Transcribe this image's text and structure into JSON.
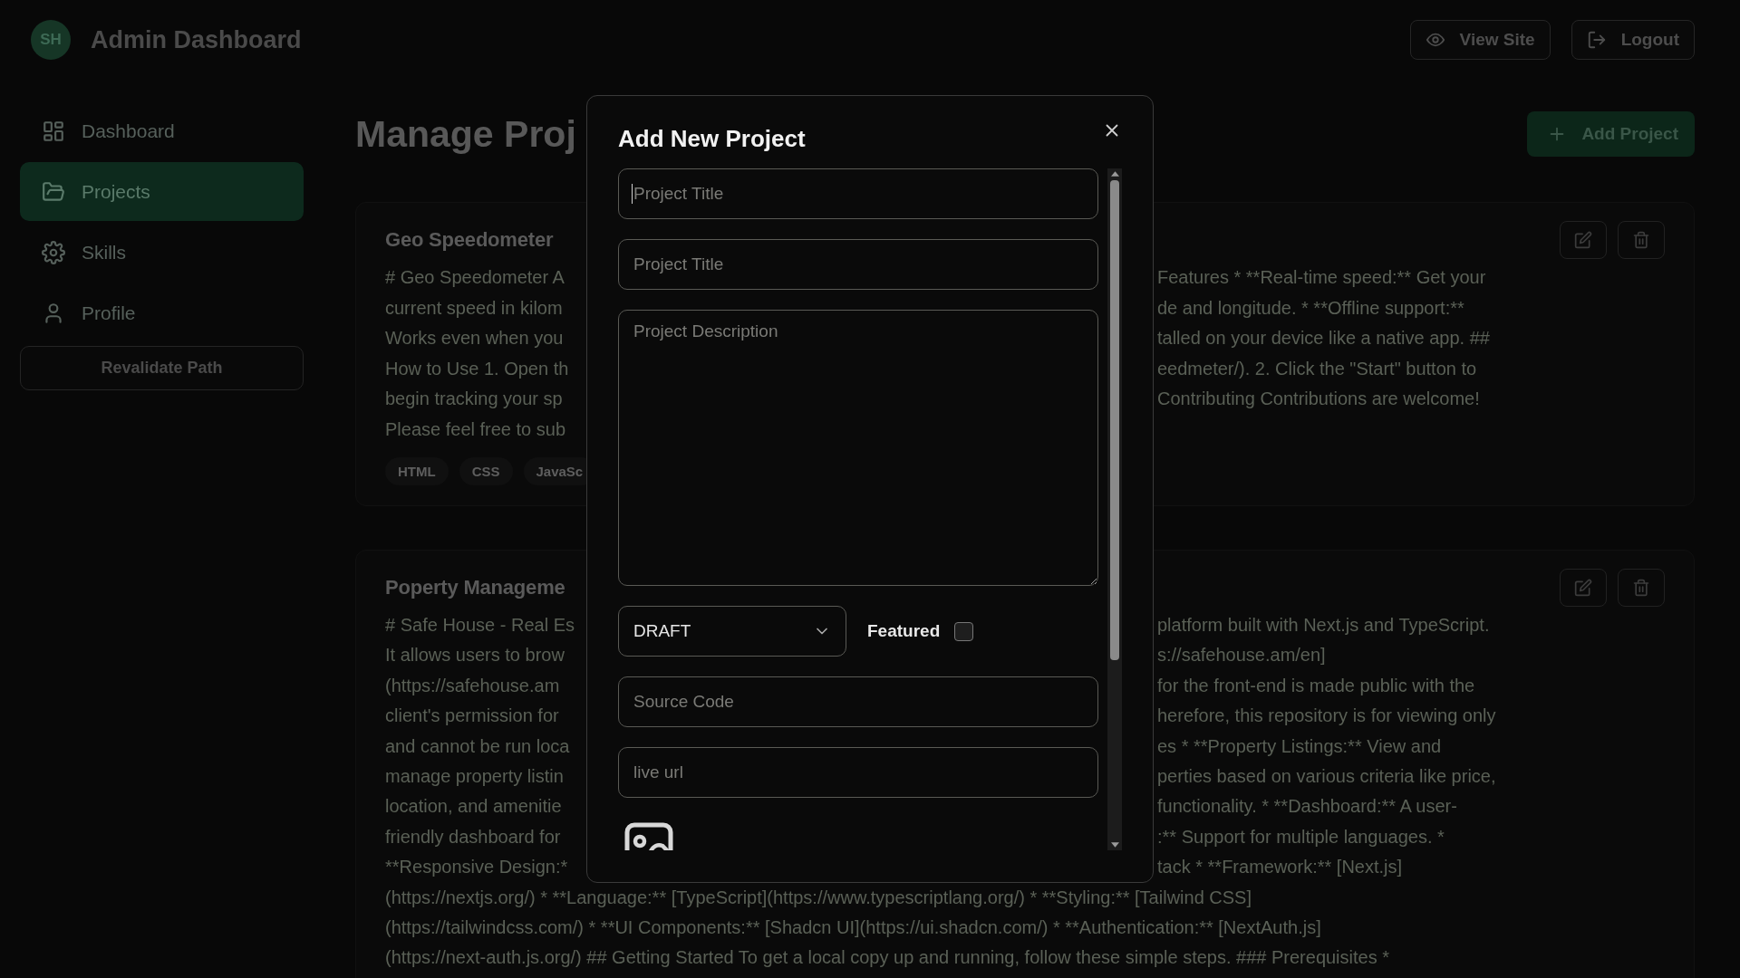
{
  "header": {
    "logo": "SH",
    "title": "Admin Dashboard",
    "buttons": [
      {
        "label": "View Site"
      },
      {
        "label": "Logout"
      }
    ]
  },
  "sidebar": {
    "items": [
      {
        "label": "Dashboard",
        "selected": false
      },
      {
        "label": "Projects",
        "selected": true
      },
      {
        "label": "Skills",
        "selected": false
      },
      {
        "label": "Profile",
        "selected": false
      }
    ],
    "action": "Revalidate Path"
  },
  "page": {
    "title": "Manage Proj",
    "add_button": "Add Project"
  },
  "projects": [
    {
      "title": "Geo Speedometer",
      "lines": [
        {
          "kind": "split",
          "left": "# Geo Speedometer A",
          "right": "Features * **Real-time speed:** Get your"
        },
        {
          "kind": "split",
          "left": "current speed in kilom",
          "right": "de and longitude. * **Offline support:**"
        },
        {
          "kind": "split",
          "left": "Works even when you",
          "right": "talled on your device like a native app. ##"
        },
        {
          "kind": "split",
          "left": "How to Use 1. Open th",
          "right": "eedmeter/). 2. Click the \"Start\" button to"
        },
        {
          "kind": "split",
          "left": "begin tracking your sp",
          "right": "Contributing Contributions are welcome!"
        },
        {
          "kind": "split",
          "left": "Please feel free to sub"
        }
      ],
      "tags": [
        "HTML",
        "CSS",
        "JavaSc"
      ]
    },
    {
      "title": "Poperty Manageme",
      "lines": [
        {
          "kind": "split",
          "left": "# Safe House - Real Es",
          "right": "platform built with Next.js and TypeScript."
        },
        {
          "kind": "split",
          "left": "It allows users to brow",
          "right": "s://safehouse.am/en]"
        },
        {
          "kind": "split",
          "left": "(https://safehouse.am",
          "right": "for the front-end is made public with the"
        },
        {
          "kind": "split",
          "left": "client's permission for",
          "right": "herefore, this repository is for viewing only"
        },
        {
          "kind": "split",
          "left": "and cannot be run loca",
          "right": "es * **Property Listings:** View and"
        },
        {
          "kind": "split",
          "left": "manage property listin",
          "right": "perties based on various criteria like price,"
        },
        {
          "kind": "split",
          "left": "location, and amenitie",
          "right": "functionality. * **Dashboard:** A user-"
        },
        {
          "kind": "split",
          "left": "friendly dashboard for",
          "right": ":** Support for multiple languages. *"
        },
        {
          "kind": "split",
          "left": "**Responsive Design:*",
          "right": "tack * **Framework:** [Next.js]"
        },
        {
          "kind": "full",
          "text": "(https://nextjs.org/) * **Language:** [TypeScript](https://www.typescriptlang.org/) * **Styling:** [Tailwind CSS]"
        },
        {
          "kind": "full",
          "text": "(https://tailwindcss.com/) * **UI Components:** [Shadcn UI](https://ui.shadcn.com/) * **Authentication:** [NextAuth.js]"
        },
        {
          "kind": "full",
          "text": "(https://next-auth.js.org/) ## Getting Started To get a local copy up and running, follow these simple steps. ### Prerequisites *"
        }
      ]
    }
  ],
  "dialog": {
    "title": "Add New Project",
    "fields": [
      {
        "kind": "input",
        "placeholder": "Project Title",
        "focused": true
      },
      {
        "kind": "input",
        "placeholder": "Project Title",
        "focused": false
      },
      {
        "kind": "textarea",
        "placeholder": "Project Description"
      },
      {
        "kind": "status_row",
        "value": "DRAFT",
        "checkbox_label": "Featured",
        "checked": false
      },
      {
        "kind": "input",
        "placeholder": "Source Code",
        "focused": false
      },
      {
        "kind": "input",
        "placeholder": "live url",
        "focused": false
      },
      {
        "kind": "image_picker"
      }
    ]
  }
}
